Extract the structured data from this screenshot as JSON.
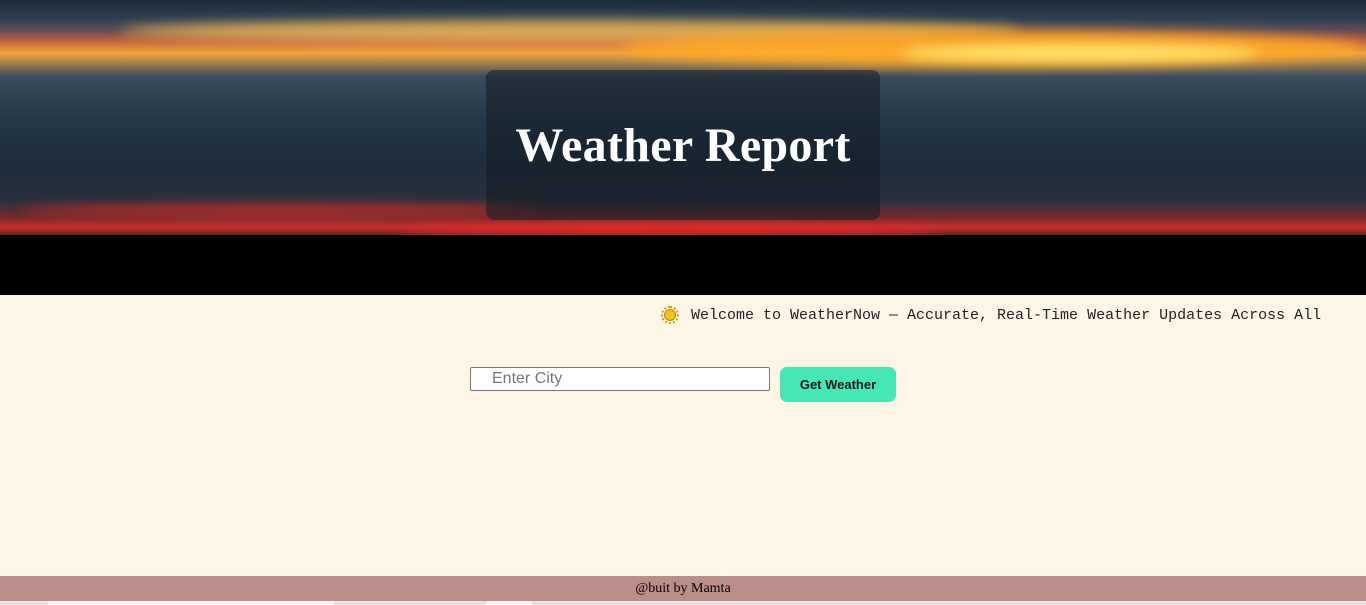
{
  "header": {
    "title": "Weather Report"
  },
  "marquee": {
    "icon": "sun-icon",
    "text": "Welcome to WeatherNow — Accurate, Real-Time Weather Updates Across All"
  },
  "search": {
    "placeholder": "Enter City",
    "value": "",
    "button_label": "Get Weather"
  },
  "footer": {
    "text": "@buit by Mamta"
  },
  "colors": {
    "page_background": "#fdf6e6",
    "button": "#46e6b5",
    "footer": "#bc8e8a"
  }
}
